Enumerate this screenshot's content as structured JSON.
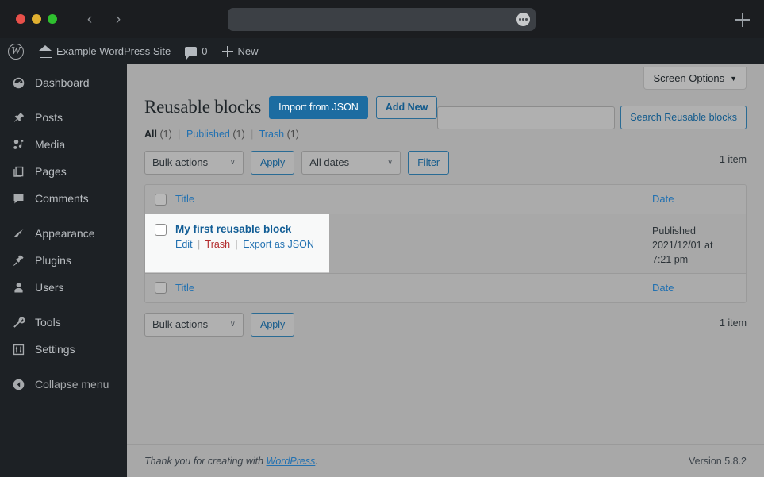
{
  "browser": {
    "url_value": "",
    "dots_icon": "more-dots-icon",
    "back_glyph": "‹",
    "forward_glyph": "›"
  },
  "adminbar": {
    "wp_logo_glyph": "W",
    "site_name": "Example WordPress Site",
    "comment_count": "0",
    "new_label": "New"
  },
  "sidebar": {
    "items": [
      {
        "label": "Dashboard",
        "icon": "dashboard-icon"
      },
      {
        "label": "Posts",
        "icon": "pin-icon"
      },
      {
        "label": "Media",
        "icon": "media-icon"
      },
      {
        "label": "Pages",
        "icon": "pages-icon"
      },
      {
        "label": "Comments",
        "icon": "comment-icon"
      },
      {
        "label": "Appearance",
        "icon": "brush-icon"
      },
      {
        "label": "Plugins",
        "icon": "plug-icon"
      },
      {
        "label": "Users",
        "icon": "user-icon"
      },
      {
        "label": "Tools",
        "icon": "wrench-icon"
      },
      {
        "label": "Settings",
        "icon": "sliders-icon"
      },
      {
        "label": "Collapse menu",
        "icon": "collapse-arrow-icon"
      }
    ]
  },
  "screen_options": {
    "label": "Screen Options",
    "caret": "▼"
  },
  "page": {
    "title": "Reusable blocks",
    "import_button": "Import from JSON",
    "add_new_button": "Add New"
  },
  "filters": {
    "all": {
      "label": "All",
      "count": "(1)"
    },
    "published": {
      "label": "Published",
      "count": "(1)"
    },
    "trash": {
      "label": "Trash",
      "count": "(1)"
    },
    "separator": "|"
  },
  "search": {
    "value": "",
    "placeholder": "",
    "button_label": "Search Reusable blocks"
  },
  "tablenav_top": {
    "bulk_actions": "Bulk actions",
    "apply": "Apply",
    "dates": "All dates",
    "filter": "Filter",
    "item_count": "1 item",
    "chevron": "∨"
  },
  "tablenav_bottom": {
    "bulk_actions": "Bulk actions",
    "apply": "Apply",
    "item_count": "1 item",
    "chevron": "∨"
  },
  "table": {
    "columns": {
      "title": "Title",
      "date": "Date"
    },
    "rows": [
      {
        "title": "My first reusable block",
        "actions": {
          "edit": "Edit",
          "trash": "Trash",
          "export": "Export as JSON",
          "sep": "|"
        },
        "date_status": "Published",
        "date_value": "2021/12/01 at",
        "date_time": "7:21 pm"
      }
    ]
  },
  "footer": {
    "thanks_prefix": "Thank you for creating with ",
    "thanks_link": "WordPress",
    "thanks_suffix": ".",
    "version": "Version 5.8.2"
  },
  "colors": {
    "accent_blue": "#2271b1",
    "primary_button": "#1c6ca1",
    "trash_red": "#b32d2e",
    "admin_dark": "#1d2125"
  }
}
